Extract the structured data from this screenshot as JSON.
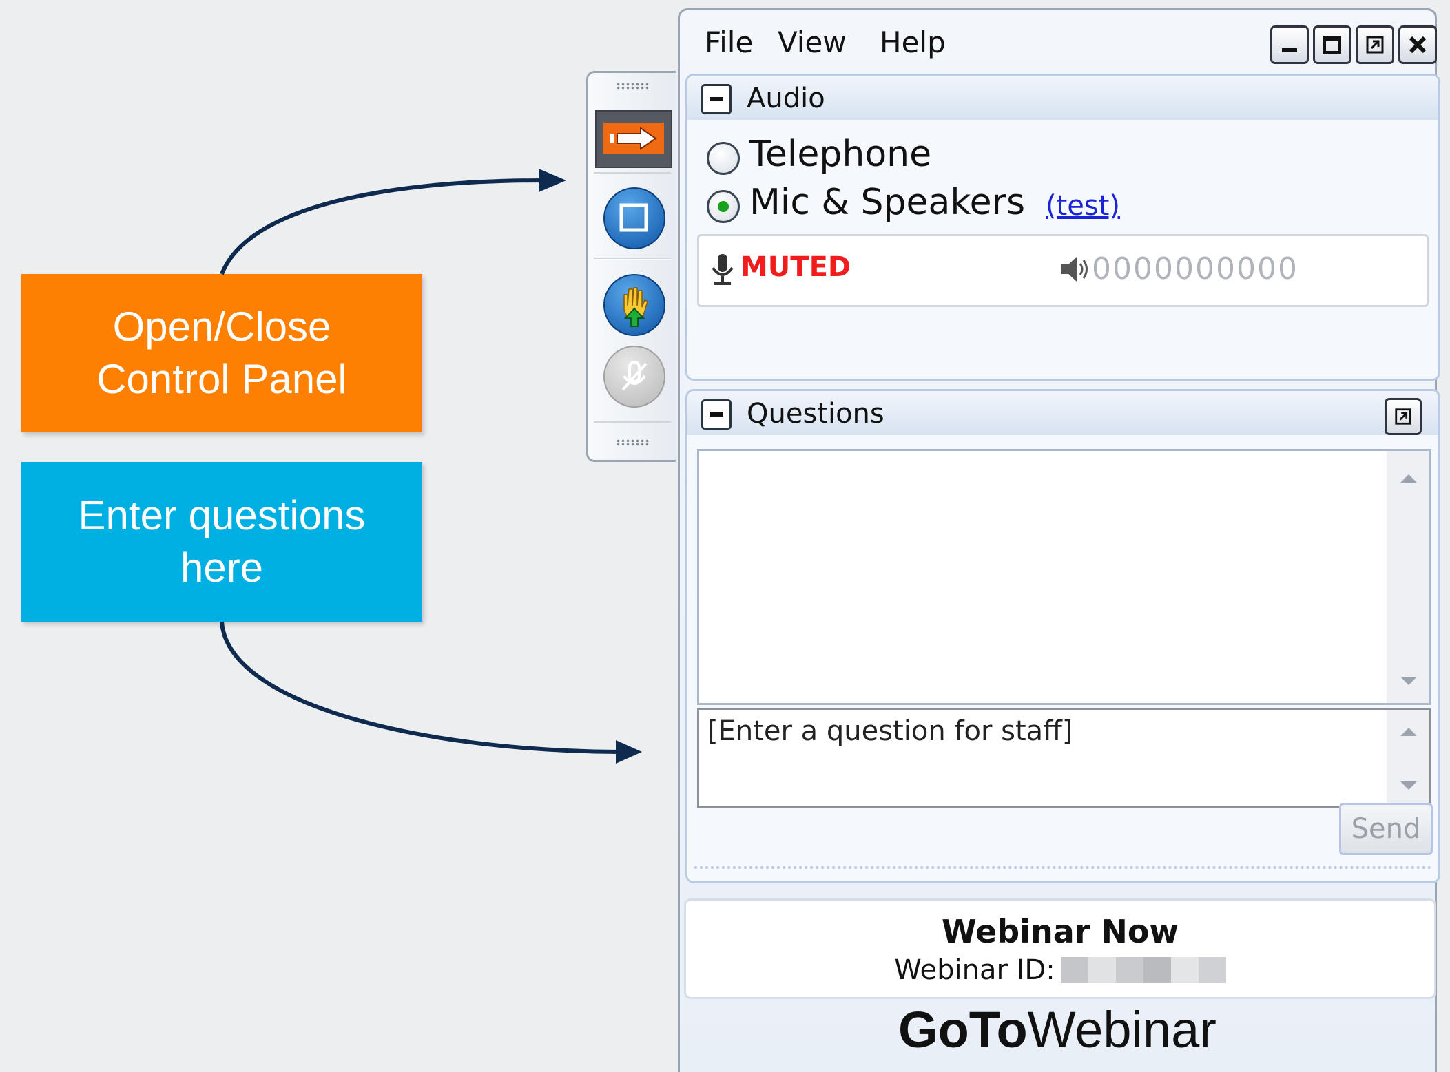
{
  "callouts": {
    "open_close": "Open/Close\nControl Panel",
    "enter_questions": "Enter questions\nhere"
  },
  "colors": {
    "orange_callout": "#fd8003",
    "blue_callout": "#00b0e2",
    "arrow": "#0f2a4f",
    "muted_text": "#f11c1c",
    "link": "#1b23d6"
  },
  "toolbar": {
    "icons": [
      "show-hide-panel-arrow-icon",
      "screen-share-icon",
      "raise-hand-icon",
      "mute-mic-icon"
    ]
  },
  "menu": {
    "file": "File",
    "view": "View",
    "help": "Help"
  },
  "window_buttons": [
    "minimize-icon",
    "maximize-icon",
    "restore-icon",
    "close-icon"
  ],
  "audio": {
    "title": "Audio",
    "options": [
      {
        "label": "Telephone",
        "selected": false
      },
      {
        "label": "Mic & Speakers",
        "selected": true
      }
    ],
    "test_link": "(test)",
    "mic_status": "MUTED",
    "speaker_level": "0000000000"
  },
  "questions": {
    "title": "Questions",
    "input_placeholder": "[Enter a question for staff]",
    "send_label": "Send"
  },
  "webinar": {
    "title": "Webinar Now",
    "id_label": "Webinar ID:"
  },
  "brand": {
    "bold": "GoTo",
    "light": "Webinar"
  }
}
